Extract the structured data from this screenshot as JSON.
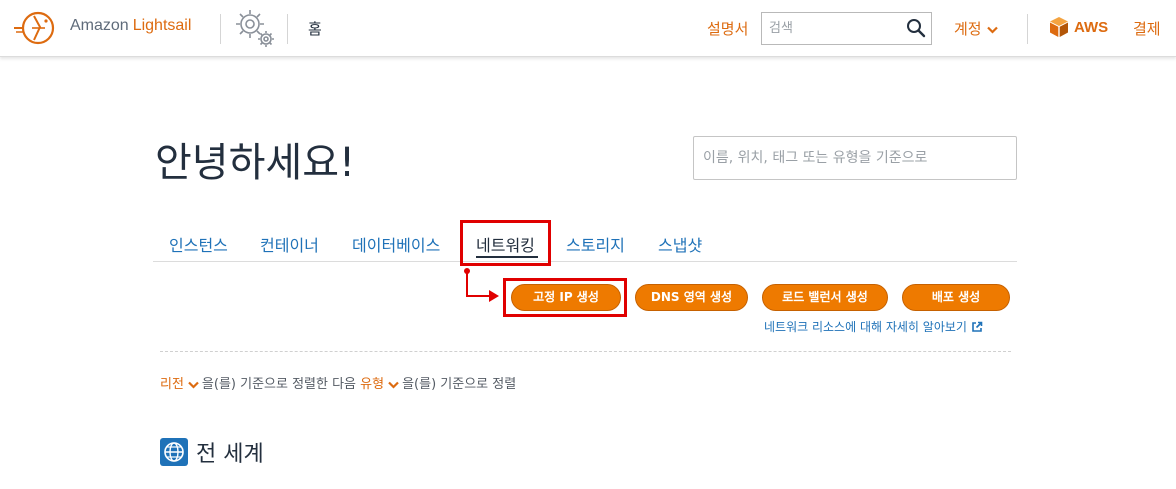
{
  "header": {
    "brand_prefix": "Amazon",
    "brand_name": "Lightsail",
    "home": "홈",
    "docs": "설명서",
    "search_placeholder": "검색",
    "account": "계정",
    "aws": "AWS",
    "billing": "결제"
  },
  "main": {
    "greeting": "안녕하세요!",
    "filter_placeholder": "이름, 위치, 태그 또는 유형을 기준으로",
    "tabs": [
      {
        "label": "인스턴스"
      },
      {
        "label": "컨테이너"
      },
      {
        "label": "데이터베이스"
      },
      {
        "label": "네트워킹"
      },
      {
        "label": "스토리지"
      },
      {
        "label": "스냅샷"
      }
    ],
    "active_tab": "네트워킹",
    "actions": [
      {
        "label": "고정 IP 생성"
      },
      {
        "label": "DNS 영역 생성"
      },
      {
        "label": "로드 밸런서 생성"
      },
      {
        "label": "배포 생성"
      }
    ],
    "learn_more": "네트워크 리소스에 대해 자세히 알아보기",
    "sort": {
      "field1": "리전",
      "text1": "을(를) 기준으로 정렬한 다음",
      "field2": "유형",
      "text2": "을(를) 기준으로 정렬"
    },
    "section_title": "전 세계"
  },
  "colors": {
    "accent_orange": "#ee7a00",
    "link_blue": "#1f72b8",
    "highlight_red": "#e00000",
    "text_dark": "#232f3e"
  },
  "icons": [
    "lightsail-logo-icon",
    "settings-gear-icon",
    "search-icon",
    "chevron-down-icon",
    "aws-cube-icon",
    "external-link-icon",
    "globe-icon"
  ]
}
